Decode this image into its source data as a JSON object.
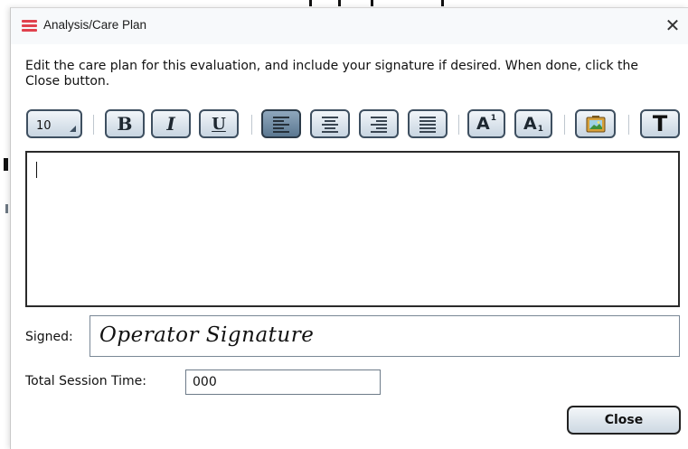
{
  "window": {
    "title": "Analysis/Care Plan",
    "close_glyph": "✕"
  },
  "instructions": "Edit the care plan for this evaluation, and include your signature if desired. When done, click the Close button.",
  "toolbar": {
    "font_size": "10",
    "bold_glyph": "B",
    "italic_glyph": "I",
    "underline_glyph": "U",
    "superscript_glyph": "A",
    "superscript_mark": "1",
    "subscript_glyph": "A",
    "subscript_mark": "1",
    "text_color_glyph": "T",
    "active_alignment": "left",
    "icons": [
      "bold-icon",
      "italic-icon",
      "underline-icon",
      "align-left-icon",
      "align-center-icon",
      "align-right-icon",
      "align-justify-icon",
      "superscript-icon",
      "subscript-icon",
      "insert-image-icon",
      "text-format-icon"
    ]
  },
  "editor": {
    "content": ""
  },
  "signature": {
    "label": "Signed:",
    "value": "Operator Signature"
  },
  "session_time": {
    "label": "Total Session Time:",
    "value": "000"
  },
  "buttons": {
    "close_label": "Close"
  },
  "colors": {
    "accent_icon": "#e0414d",
    "toolbar_border": "#3e4f60",
    "active_button": "#6f8aa3"
  }
}
